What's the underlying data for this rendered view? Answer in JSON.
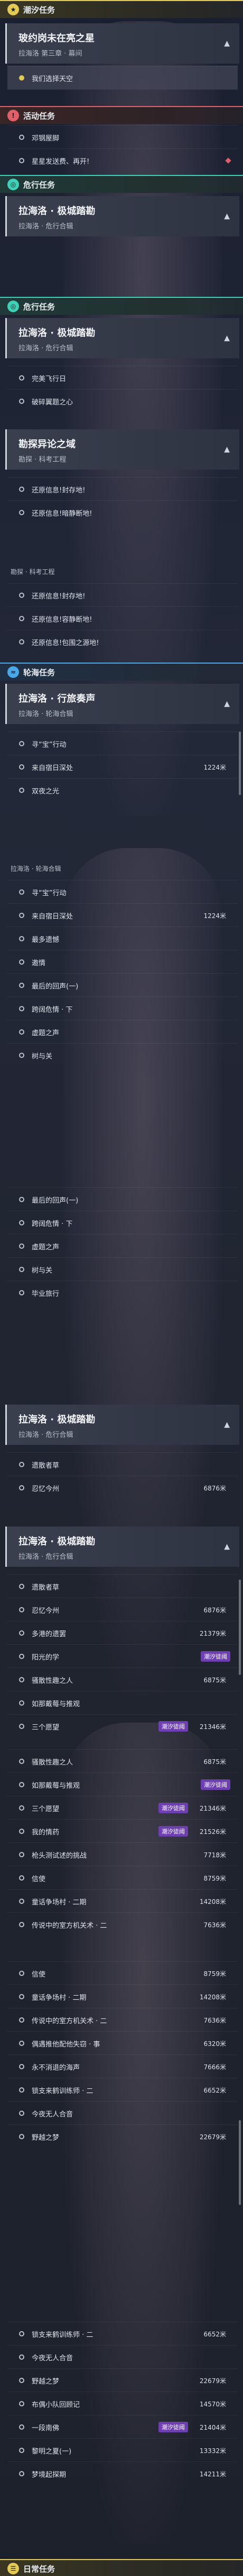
{
  "colors": {
    "yellow": "#e3c955",
    "red": "#e0606a",
    "teal": "#3fd1b8",
    "blue": "#4aa8e8",
    "purple": "#6d3fb0"
  },
  "hdr_tide": "潮汐任务",
  "card1": {
    "title": "玻约岗未在亮之星",
    "sub": "拉海洛 第三章 · 幕间"
  },
  "row_tide_sel": "我们选择天空",
  "hdr_event": "活动任务",
  "event_rows": [
    "邓钢屋脚",
    "星星发送费、再开!"
  ],
  "hdr_side1": "危行任务",
  "card2": {
    "title": "拉海洛 · 极城踏勘",
    "sub": "拉海洛 · 危行合辑"
  },
  "hdr_side2": "危行任务",
  "card3": {
    "title": "拉海洛 · 极城踏勘",
    "sub": "拉海洛 · 危行合辑"
  },
  "rows_a": [
    "完美飞行日",
    "破碎翼题之心"
  ],
  "card4": {
    "title": "勘探异论之域",
    "sub": "勘探 · 科考工程"
  },
  "rows_b": [
    "还原信息!封存地!",
    "还原信息!暗静断地!"
  ],
  "sub_b": "勘探 · 科考工程",
  "rows_c": [
    "还原信息!封存地!",
    "还原信息!容静断地!",
    "还原信息!包围之源地!"
  ],
  "hdr_world": "轮海任务",
  "card5": {
    "title": "拉海洛 · 行旅奏声",
    "sub": "拉海洛 · 轮海合辑"
  },
  "rows_d": [
    {
      "t": "寻“宝”行动",
      "v": ""
    },
    {
      "t": "来自宿日深处",
      "v": "1224米"
    },
    {
      "t": "双夜之光",
      "v": ""
    }
  ],
  "sub_d": "拉海洛 · 轮海合辑",
  "rows_e": [
    {
      "t": "寻“宝”行动",
      "v": ""
    },
    {
      "t": "来自宿日深处",
      "v": "1224米"
    },
    {
      "t": "最多遗憾",
      "v": ""
    },
    {
      "t": "邀情",
      "v": ""
    },
    {
      "t": "最后的回声(一)",
      "v": ""
    },
    {
      "t": "跨阔危情 · 下",
      "v": ""
    },
    {
      "t": "虚题之声",
      "v": ""
    },
    {
      "t": "树与关",
      "v": ""
    }
  ],
  "rows_f": [
    {
      "t": "最后的回声(一)",
      "v": ""
    },
    {
      "t": "跨阔危情 · 下",
      "v": ""
    },
    {
      "t": "虚题之声",
      "v": ""
    },
    {
      "t": "树与关",
      "v": ""
    },
    {
      "t": "毕业旅行",
      "v": ""
    }
  ],
  "card6": {
    "title": "拉海洛 · 极城踏勘",
    "sub": "拉海洛 · 危行合辑"
  },
  "rows_g": [
    {
      "t": "遗散者草",
      "v": ""
    },
    {
      "t": "忍忆今州",
      "v": "6876米"
    }
  ],
  "card7": {
    "title": "拉海洛 · 极城踏勘",
    "sub": "拉海洛 · 危行合辑"
  },
  "badge_label": "潮汐徒阈",
  "rows_h": [
    {
      "t": "遗散者草",
      "v": ""
    },
    {
      "t": "忍忆今州",
      "v": "6876米"
    },
    {
      "t": "多港的遗罢",
      "v": "21379米"
    },
    {
      "t": "阳光的学",
      "v": ""
    },
    {
      "t": "骚散性趣之人",
      "v": "6875米"
    },
    {
      "t": "如那戴莓与推观",
      "v": ""
    },
    {
      "t": "三个愿望",
      "v": "21346米"
    }
  ],
  "rows_i": [
    {
      "t": "骚散性趣之人",
      "v": "6875米"
    },
    {
      "t": "如那戴莓与推观",
      "v": ""
    },
    {
      "t": "三个愿望",
      "v": "21346米"
    },
    {
      "t": "我的情药",
      "v": "21526米"
    },
    {
      "t": "枪头测试述的挑战",
      "v": "7718米"
    },
    {
      "t": "信使",
      "v": "8759米"
    },
    {
      "t": "童话争场村 · 二期",
      "v": "14208米"
    },
    {
      "t": "传说中的室方机关术 · 二",
      "v": "7636米"
    }
  ],
  "rows_j": [
    {
      "t": "信使",
      "v": "8759米"
    },
    {
      "t": "童话争场村 · 二期",
      "v": "14208米"
    },
    {
      "t": "传说中的室方机关术 · 二",
      "v": "7636米"
    },
    {
      "t": "偶遇推他配他失窃 · 事",
      "v": "6320米"
    },
    {
      "t": "永不消退的海声",
      "v": "7666米"
    },
    {
      "t": "锁支来鹤训练师 · 二",
      "v": "6652米"
    },
    {
      "t": "今夜无人合音",
      "v": ""
    },
    {
      "t": "野越之梦",
      "v": "22679米"
    }
  ],
  "rows_k": [
    {
      "t": "锁支来鹤训练师 · 二",
      "v": "6652米"
    },
    {
      "t": "今夜无人合音",
      "v": ""
    },
    {
      "t": "野越之梦",
      "v": "22679米"
    },
    {
      "t": "布偶小队回顾记",
      "v": "14570米"
    },
    {
      "t": "一段南佛",
      "v": "21404米"
    },
    {
      "t": "黎明之夏(一)",
      "v": "13332米"
    },
    {
      "t": "梦境起探期",
      "v": "14211米"
    }
  ],
  "hdr_daily": "日常任务"
}
